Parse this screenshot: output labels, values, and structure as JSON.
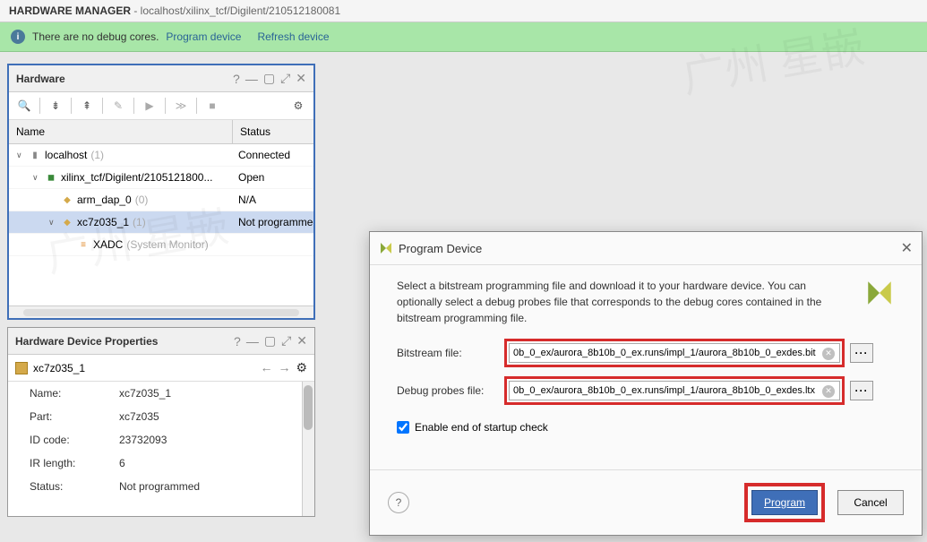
{
  "header": {
    "title": "HARDWARE MANAGER",
    "subtitle": " - localhost/xilinx_tcf/Digilent/210512180081"
  },
  "info": {
    "msg": "There are no debug cores.",
    "link1": "Program device",
    "link2": "Refresh device"
  },
  "hw_panel": {
    "title": "Hardware",
    "col_name": "Name",
    "col_status": "Status",
    "rows": [
      {
        "indent": 0,
        "caret": "∨",
        "icon": "server",
        "label": "localhost",
        "suffix": "(1)",
        "status": "Connected"
      },
      {
        "indent": 1,
        "caret": "∨",
        "icon": "cable",
        "label": "xilinx_tcf/Digilent/2105121800...",
        "suffix": "",
        "status": "Open"
      },
      {
        "indent": 2,
        "caret": "",
        "icon": "chip",
        "label": "arm_dap_0",
        "suffix": "(0)",
        "status": "N/A"
      },
      {
        "indent": 2,
        "caret": "∨",
        "icon": "chip",
        "label": "xc7z035_1",
        "suffix": "(1)",
        "status": "Not programmed",
        "selected": true
      },
      {
        "indent": 3,
        "caret": "",
        "icon": "xadc",
        "label": "XADC",
        "suffix": "(System Monitor)",
        "status": ""
      }
    ]
  },
  "prop_panel": {
    "title": "Hardware Device Properties",
    "device": "xc7z035_1",
    "rows": [
      {
        "k": "Name:",
        "v": "xc7z035_1"
      },
      {
        "k": "Part:",
        "v": "xc7z035"
      },
      {
        "k": "ID code:",
        "v": "23732093"
      },
      {
        "k": "IR length:",
        "v": "6"
      },
      {
        "k": "Status:",
        "v": "Not programmed"
      }
    ]
  },
  "dialog": {
    "title": "Program Device",
    "desc": "Select a bitstream programming file and download it to your hardware device. You can optionally select a debug probes file that corresponds to the debug cores contained in the bitstream programming file.",
    "bit_label": "Bitstream file:",
    "bit_val": "0b_0_ex/aurora_8b10b_0_ex.runs/impl_1/aurora_8b10b_0_exdes.bit",
    "ltx_label": "Debug probes file:",
    "ltx_val": "0b_0_ex/aurora_8b10b_0_ex.runs/impl_1/aurora_8b10b_0_exdes.ltx",
    "check_label": "Enable end of startup check",
    "program": "Program",
    "cancel": "Cancel",
    "browse": "···"
  }
}
